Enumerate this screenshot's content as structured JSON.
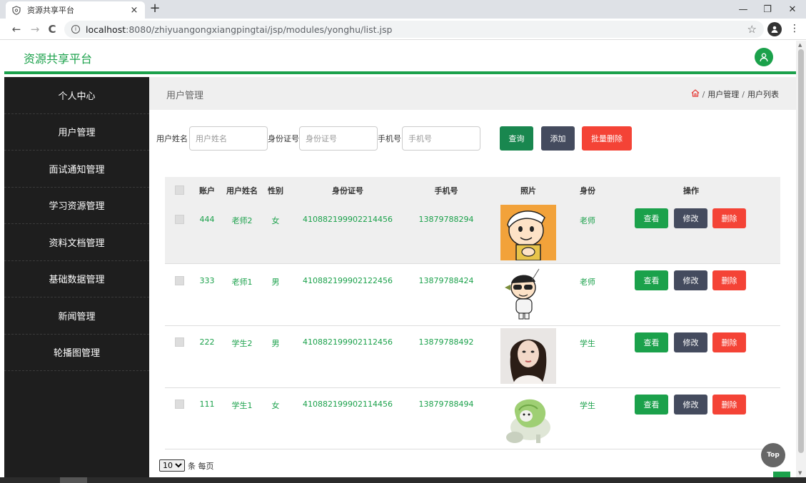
{
  "browser": {
    "tab_title": "资源共享平台",
    "tab_close": "×",
    "new_tab": "+",
    "url_host": "localhost",
    "url_path": ":8080/zhiyuangongxiangpingtai/jsp/modules/yonghu/list.jsp",
    "back": "←",
    "forward": "→",
    "reload": "C",
    "star": "☆",
    "minimize": "—",
    "restore": "❐",
    "close": "✕",
    "menu": "⋮"
  },
  "app": {
    "brand": "资源共享平台"
  },
  "sidebar": {
    "items": [
      {
        "label": "个人中心"
      },
      {
        "label": "用户管理"
      },
      {
        "label": "面试通知管理"
      },
      {
        "label": "学习资源管理"
      },
      {
        "label": "资料文档管理"
      },
      {
        "label": "基础数据管理"
      },
      {
        "label": "新闻管理"
      },
      {
        "label": "轮播图管理"
      }
    ]
  },
  "main": {
    "title": "用户管理",
    "breadcrumb": [
      "用户管理",
      "用户列表"
    ],
    "breadcrumb_sep": "/"
  },
  "filter": {
    "name_label": "用户姓名",
    "name_placeholder": "用户姓名",
    "id_label": "身份证号",
    "id_placeholder": "身份证号",
    "phone_label": "手机号",
    "phone_placeholder": "手机号",
    "search_button": "查询",
    "add_button": "添加",
    "batch_delete_button": "批量删除"
  },
  "table": {
    "headers": [
      "账户",
      "用户姓名",
      "性别",
      "身份证号",
      "手机号",
      "照片",
      "身份",
      "操作"
    ],
    "rows": [
      {
        "account": "444",
        "name": "老师2",
        "gender": "女",
        "id_number": "410882199902214456",
        "phone": "13879788294",
        "role": "老师",
        "photo": "cartoon-boy-with-cap"
      },
      {
        "account": "333",
        "name": "老师1",
        "gender": "男",
        "id_number": "410882199902122456",
        "phone": "13879788424",
        "role": "老师",
        "photo": "cartoon-boy-sunglasses"
      },
      {
        "account": "222",
        "name": "学生2",
        "gender": "男",
        "id_number": "410882199902112456",
        "phone": "13879788492",
        "role": "学生",
        "photo": "woman-portrait"
      },
      {
        "account": "111",
        "name": "学生1",
        "gender": "女",
        "id_number": "410882199902114456",
        "phone": "13879788494",
        "role": "学生",
        "photo": "cabbage-dog"
      }
    ],
    "view_label": "查看",
    "edit_label": "修改",
    "delete_label": "删除"
  },
  "pager": {
    "page_size": "10",
    "suffix": "条 每页"
  },
  "top_button": "Top",
  "colors": {
    "primary_green": "#1ba14b",
    "search_green": "#19874f",
    "dark_button": "#444b5e",
    "danger_red": "#f44336",
    "sidebar_bg": "#1e1e1e"
  }
}
